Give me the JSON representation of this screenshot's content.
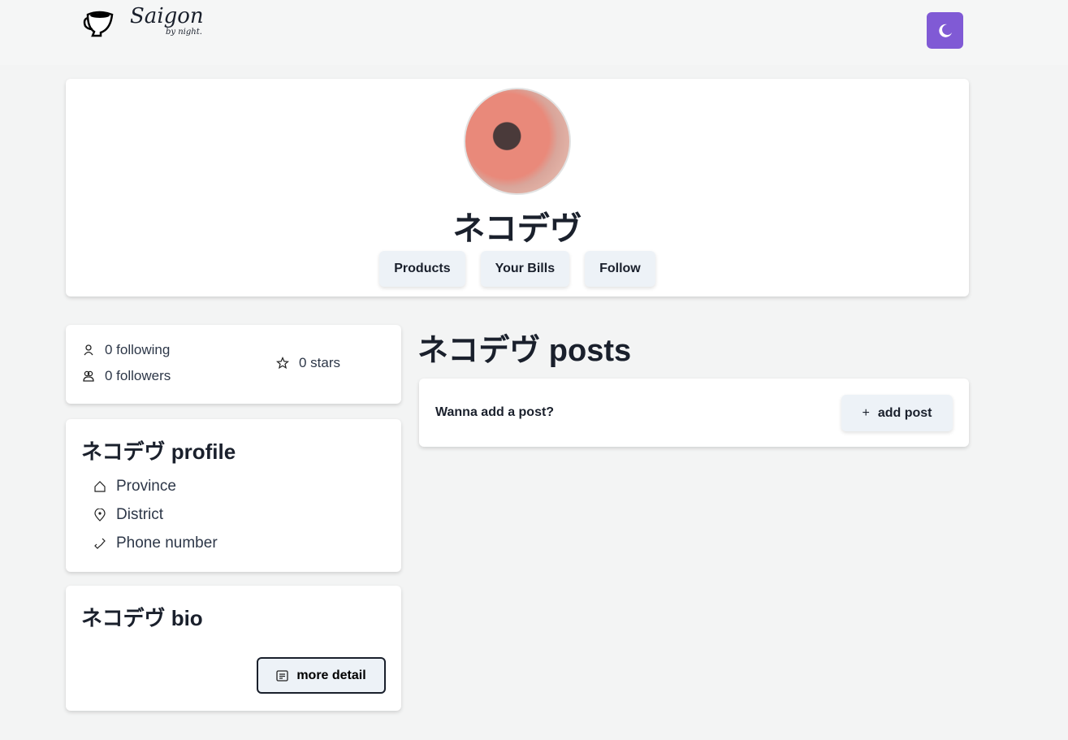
{
  "header": {
    "logo_text": "Saigon",
    "logo_subtext": "by night.",
    "theme_toggle_icon": "moon-icon",
    "accent": "#805ad5"
  },
  "profile_header": {
    "name": "ネコデヴ",
    "buttons": [
      "Products",
      "Your Bills",
      "Follow"
    ]
  },
  "stats": {
    "following": "0 following",
    "followers": "0 followers",
    "stars": "0 stars"
  },
  "profile_card": {
    "title": "ネコデヴ profile",
    "items": [
      "Province",
      "District",
      "Phone number"
    ]
  },
  "bio_card": {
    "title": "ネコデヴ bio",
    "more_label": "more detail"
  },
  "posts": {
    "title": "ネコデヴ posts",
    "prompt": "Wanna add a post?",
    "add_label": "add post"
  }
}
